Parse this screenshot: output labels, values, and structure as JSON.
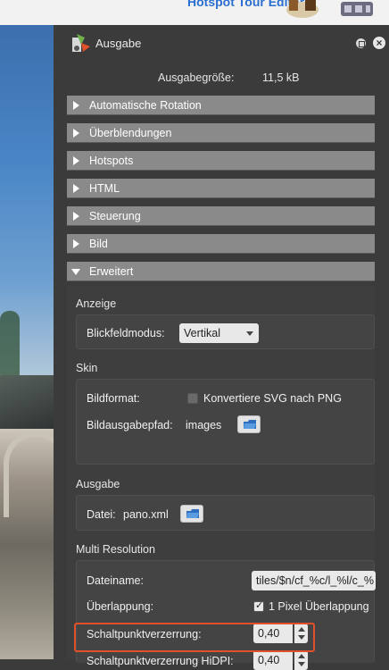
{
  "header": {
    "brand_text": "Hotspot Tour Editor"
  },
  "panel": {
    "title": "Ausgabe",
    "output_size_label": "Ausgabegröße:",
    "output_size_value": "11,5 kB",
    "sections": [
      {
        "label": "Automatische Rotation",
        "expanded": false
      },
      {
        "label": "Überblendungen",
        "expanded": false
      },
      {
        "label": "Hotspots",
        "expanded": false
      },
      {
        "label": "HTML",
        "expanded": false
      },
      {
        "label": "Steuerung",
        "expanded": false
      },
      {
        "label": "Bild",
        "expanded": false
      },
      {
        "label": "Erweitert",
        "expanded": true
      }
    ],
    "erweitert": {
      "anzeige": {
        "title": "Anzeige",
        "fov_mode_label": "Blickfeldmodus:",
        "fov_mode_value": "Vertikal"
      },
      "skin": {
        "title": "Skin",
        "image_format_label": "Bildformat:",
        "convert_svg_label": "Konvertiere SVG nach PNG",
        "convert_svg_checked": false,
        "image_output_path_label": "Bildausgabepfad:",
        "image_output_path_value": "images"
      },
      "ausgabe": {
        "title": "Ausgabe",
        "file_label": "Datei:",
        "file_value": "pano.xml"
      },
      "multi_resolution": {
        "title": "Multi Resolution",
        "filename_label": "Dateiname:",
        "filename_value": "tiles/$n/cf_%c/l_%l/c_%",
        "overlap_label": "Überlappung:",
        "overlap_checkbox_label": "1 Pixel Überlappung",
        "overlap_checked": true,
        "hotspot_distortion_label": "Schaltpunktverzerrung:",
        "hotspot_distortion_value": "0,40",
        "hotspot_distortion_hidpi_label": "Schaltpunktverzerrung HiDPI:",
        "hotspot_distortion_hidpi_value": "0,40"
      }
    }
  },
  "colors": {
    "panel_bg": "#3b3b3b",
    "section_header_bg": "#8a8a8a",
    "highlight_border": "#e0502a",
    "brand_blue": "#2a6fd1"
  },
  "icons": [
    "app-logo-icon",
    "restore-icon",
    "close-icon",
    "folder-icon",
    "triangle-right-icon",
    "triangle-down-icon",
    "checkmark-icon"
  ]
}
